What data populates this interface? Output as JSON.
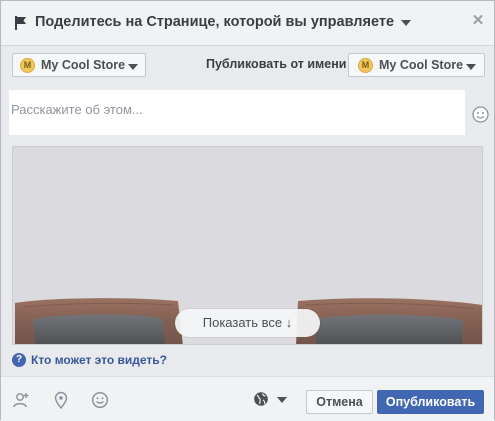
{
  "header": {
    "title": "Поделитесь на Странице, которой вы управляете",
    "flag_icon": "flag-icon",
    "close_icon": "close-icon"
  },
  "identity": {
    "page_selector": {
      "badge": "M",
      "label": "My Cool Store"
    },
    "publish_as_label": "Публиковать от имени",
    "publish_as_selector": {
      "badge": "M",
      "label": "My Cool Store"
    }
  },
  "composer": {
    "placeholder": "Расскажите об этом...",
    "value": "",
    "emoji_icon": "smiley-icon"
  },
  "preview": {
    "show_all_label": "Показать все ↓",
    "image_subject": "sunglasses"
  },
  "privacy": {
    "help_icon": "question-icon",
    "link_label": "Кто может это видеть?"
  },
  "footer": {
    "icons": [
      "tag-friends-icon",
      "location-pin-icon",
      "feeling-smiley-icon"
    ],
    "audience_icon": "globe-icon",
    "cancel_label": "Отмена",
    "publish_label": "Опубликовать"
  },
  "colors": {
    "accent": "#4267b2",
    "link": "#365899",
    "badge": "#f1c75b",
    "background": "#e9eaed"
  }
}
